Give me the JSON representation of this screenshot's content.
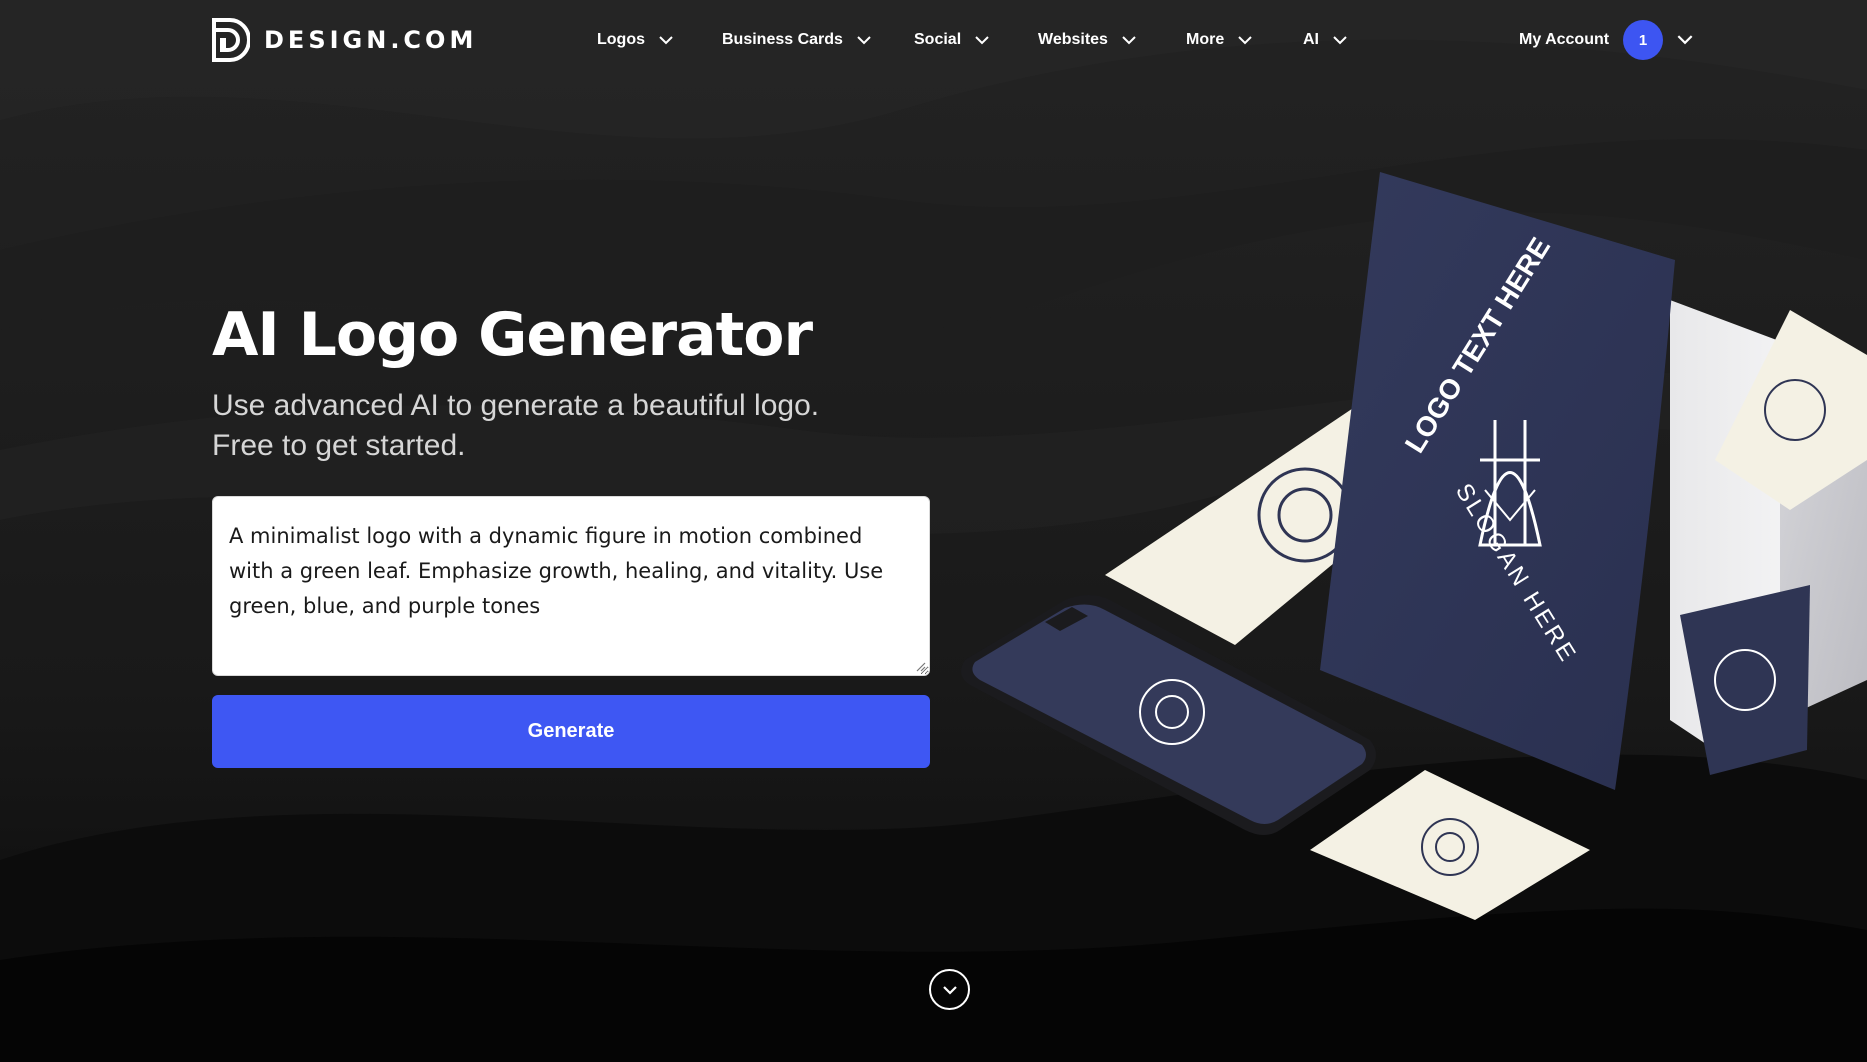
{
  "brand": {
    "name": "DESIGN.COM",
    "icon": "design-com-logo-icon"
  },
  "nav": {
    "items": [
      {
        "label": "Logos",
        "icon": "chevron-down-icon"
      },
      {
        "label": "Business Cards",
        "icon": "chevron-down-icon"
      },
      {
        "label": "Social",
        "icon": "chevron-down-icon"
      },
      {
        "label": "Websites",
        "icon": "chevron-down-icon"
      },
      {
        "label": "More",
        "icon": "chevron-down-icon"
      },
      {
        "label": "AI",
        "icon": "chevron-down-icon"
      }
    ],
    "account_label": "My Account",
    "account_badge": "1"
  },
  "hero": {
    "title": "AI Logo Generator",
    "subtitle_line1": "Use advanced AI to generate a beautiful logo.",
    "subtitle_line2": "Free to get started.",
    "prompt_value": "A minimalist logo with a dynamic figure in motion combined with a green leaf. Emphasize growth, healing, and vitality. Use green, blue, and purple tones",
    "generate_label": "Generate",
    "scroll_icon": "chevron-down-circle-icon"
  },
  "mockup": {
    "logo_text": "LOGO TEXT HERE",
    "slogan_text": "SLOGAN HERE"
  },
  "colors": {
    "accent": "#3e57f3",
    "background": "#141414",
    "navy": "#2f3554",
    "cream": "#f4f1e4"
  }
}
